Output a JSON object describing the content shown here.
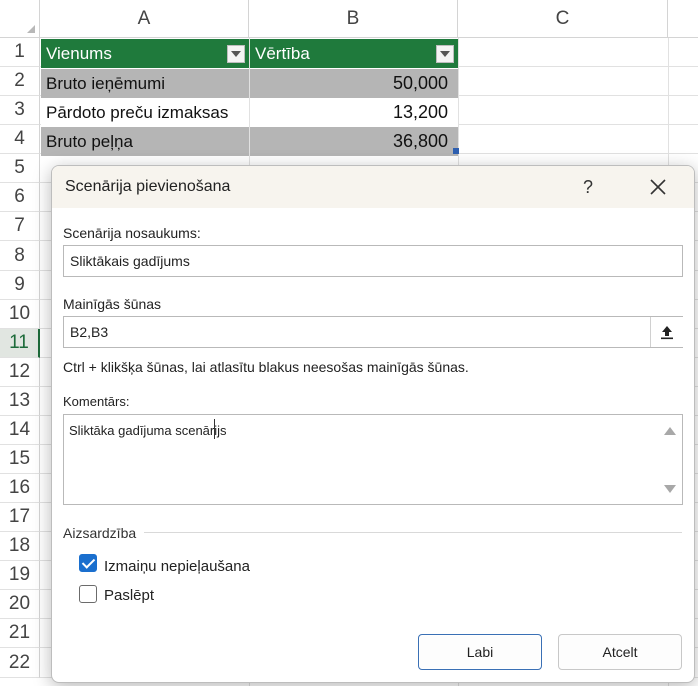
{
  "sheet": {
    "columns": [
      "A",
      "B",
      "C"
    ],
    "rows": [
      "1",
      "2",
      "3",
      "4",
      "5",
      "6",
      "7",
      "8",
      "9",
      "10",
      "11",
      "12",
      "13",
      "14",
      "15",
      "16",
      "17",
      "18",
      "19",
      "20",
      "21",
      "22"
    ],
    "active_row": "11",
    "table": {
      "headers": [
        "Vienums",
        "Vērtība"
      ],
      "rows": [
        {
          "item": "Bruto ieņēmumi",
          "value": "50,000"
        },
        {
          "item": "Pārdoto preču izmaksas",
          "value": "13,200"
        },
        {
          "item": "Bruto peļņa",
          "value": "36,800"
        }
      ],
      "header_color": "#1f7a3c",
      "band_color": "#b5b5b5"
    }
  },
  "dialog": {
    "title": "Scenārija pievienošana",
    "help_label": "?",
    "name_label": "Scenārija nosaukums:",
    "name_value": "Sliktākais gadījums",
    "cells_label": "Mainīgās šūnas",
    "cells_value": "B2,B3",
    "hint": "Ctrl + klikšķa šūnas, lai atlasītu blakus neesošas mainīgās šūnas.",
    "comment_label": "Komentārs:",
    "comment_value": "Sliktāka gadījuma scenārijs",
    "protection_label": "Aizsardzība",
    "prevent_changes_label": "Izmaiņu nepieļaušana",
    "prevent_changes_checked": true,
    "hide_label": "Paslēpt",
    "hide_checked": false,
    "ok_label": "Labi",
    "cancel_label": "Atcelt",
    "accent_color": "#1a6fce"
  }
}
